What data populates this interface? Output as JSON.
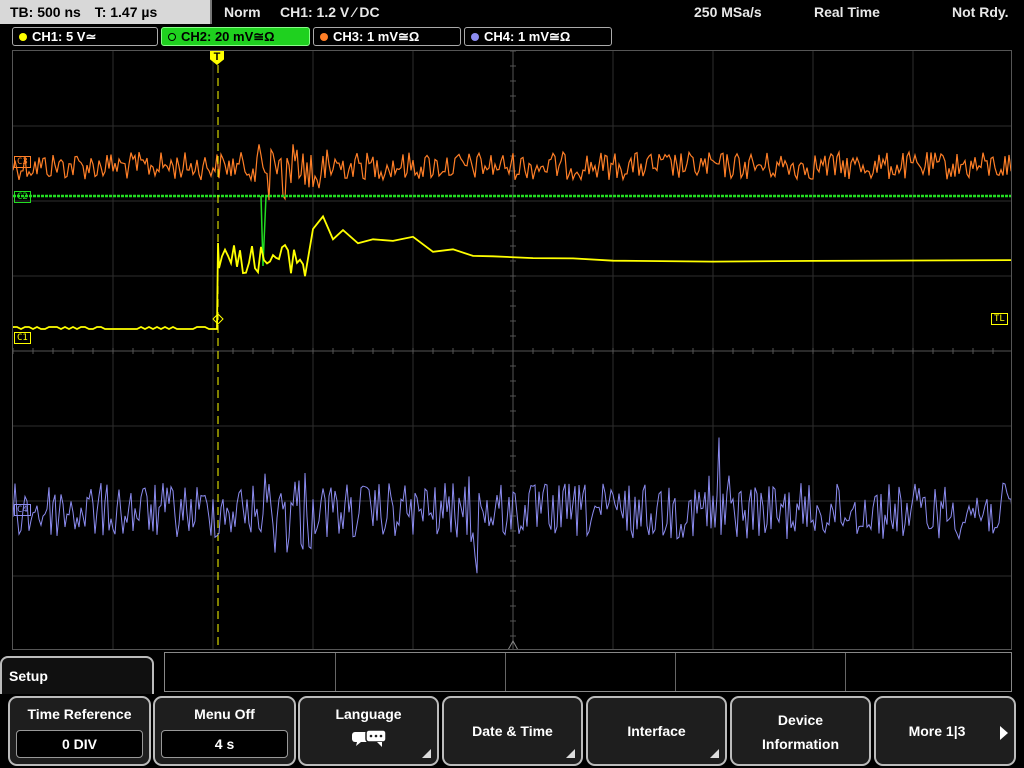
{
  "status_bar": {
    "timebase": "TB: 500 ns",
    "trigger_time": "T: 1.47 µs",
    "trigger_mode": "Norm",
    "trigger_setting": "CH1: 1.2 V ⁄ DC",
    "sample_rate": "250 MSa/s",
    "acquire_mode": "Real Time",
    "status": "Not Rdy."
  },
  "channels": [
    {
      "label": "CH1: 5 V≃",
      "color": "#ffff00",
      "active": false
    },
    {
      "label": "CH2: 20 mV≅Ω",
      "color": "#22dd22",
      "active": true
    },
    {
      "label": "CH3: 1 mV≅Ω",
      "color": "#ff7f27",
      "active": false
    },
    {
      "label": "CH4: 1 mV≅Ω",
      "color": "#8c8cf0",
      "active": false
    }
  ],
  "screen_markers": {
    "trigger_marker": "T",
    "trigger_level": "TL",
    "ch1_ref": "C1",
    "ch2_ref": "C2",
    "ch3_ref": "C3",
    "ch4_ref": "C4"
  },
  "menu": {
    "title": "Setup",
    "softkeys": [
      {
        "label": "Time Reference",
        "value": "0 DIV"
      },
      {
        "label": "Menu Off",
        "value": "4 s"
      },
      {
        "label": "Language",
        "icon": "speech-bubbles-icon"
      },
      {
        "label": "Date & Time"
      },
      {
        "label": "Interface"
      },
      {
        "label": "Device",
        "label2": "Information"
      },
      {
        "label": "More 1|3",
        "icon": "next-page-icon"
      }
    ]
  }
}
